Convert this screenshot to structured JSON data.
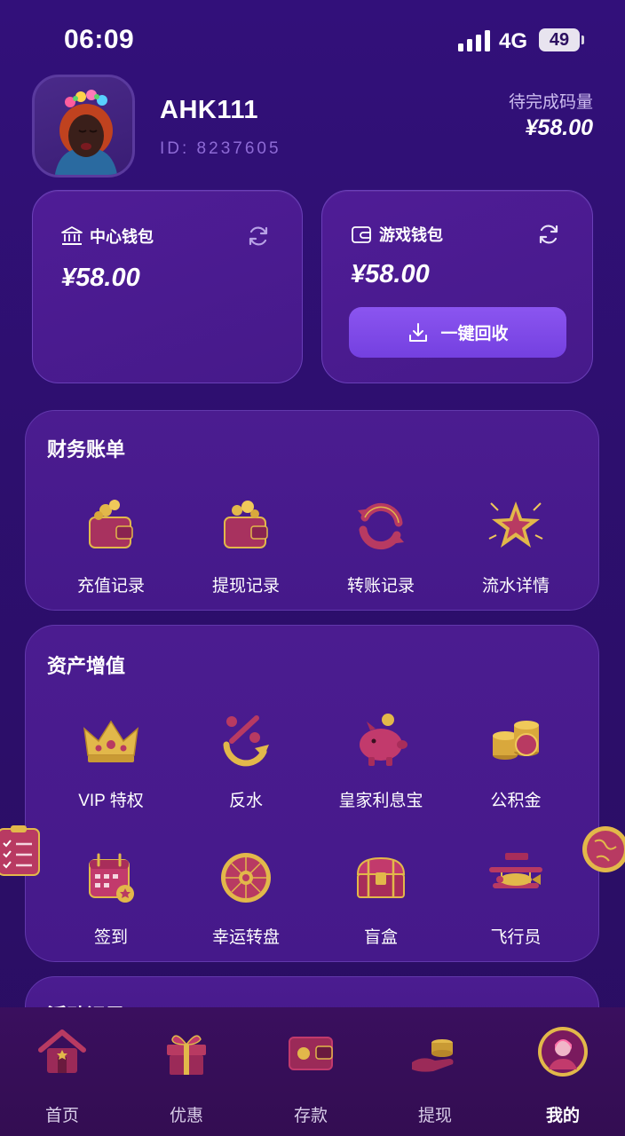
{
  "status_bar": {
    "time": "06:09",
    "network": "4G",
    "battery": "49"
  },
  "profile": {
    "username": "AHK111",
    "id_label": "ID: 8237605",
    "pending_label": "待完成码量",
    "pending_amount": "¥58.00"
  },
  "wallets": {
    "center": {
      "label": "中心钱包",
      "amount": "¥58.00",
      "icon": "bank-icon"
    },
    "game": {
      "label": "游戏钱包",
      "amount": "¥58.00",
      "icon": "wallet-icon",
      "recover_label": "一键回收"
    }
  },
  "finance": {
    "title": "财务账单",
    "items": [
      {
        "label": "充值记录",
        "icon": "wallet-coins-icon"
      },
      {
        "label": "提现记录",
        "icon": "wallet-withdraw-icon"
      },
      {
        "label": "转账记录",
        "icon": "transfer-arrows-icon"
      },
      {
        "label": "流水详情",
        "icon": "star-burst-icon"
      }
    ]
  },
  "assets": {
    "title": "资产增值",
    "items": [
      {
        "label": "VIP 特权",
        "icon": "crown-icon"
      },
      {
        "label": "反水",
        "icon": "percent-rebate-icon"
      },
      {
        "label": "皇家利息宝",
        "icon": "piggy-bank-icon"
      },
      {
        "label": "公积金",
        "icon": "coin-stack-icon"
      },
      {
        "label": "签到",
        "icon": "calendar-icon"
      },
      {
        "label": "幸运转盘",
        "icon": "lucky-wheel-icon"
      },
      {
        "label": "盲盒",
        "icon": "treasure-chest-icon"
      },
      {
        "label": "飞行员",
        "icon": "biplane-icon"
      }
    ]
  },
  "activity": {
    "title": "活动记录"
  },
  "bottom_nav": {
    "items": [
      {
        "label": "首页",
        "icon": "home-icon",
        "active": false
      },
      {
        "label": "优惠",
        "icon": "gift-icon",
        "active": false
      },
      {
        "label": "存款",
        "icon": "deposit-wallet-icon",
        "active": false
      },
      {
        "label": "提现",
        "icon": "withdraw-hand-icon",
        "active": false
      },
      {
        "label": "我的",
        "icon": "profile-avatar-icon",
        "active": true
      }
    ]
  },
  "colors": {
    "background": "#2c1060",
    "card": "#4b1c90",
    "accent_button": "#7f4ae8",
    "muted_text": "#8e6bd6",
    "icon_primary": "#9b2a58",
    "icon_gold": "#e2b84a"
  }
}
